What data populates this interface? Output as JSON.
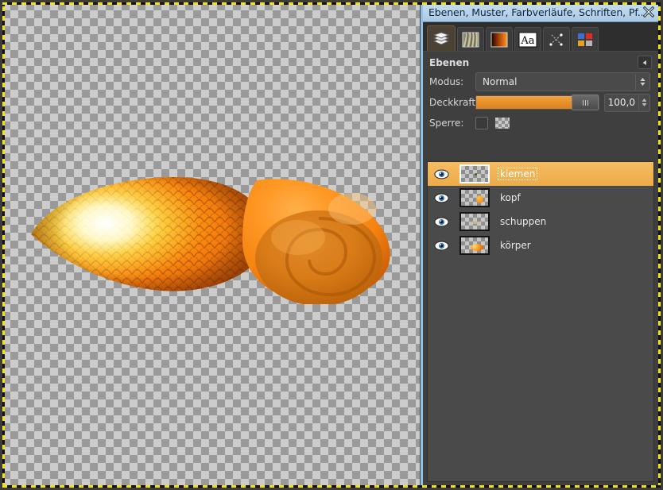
{
  "window": {
    "title": "Ebenen, Muster, Farbverläufe, Schriften, Pf...",
    "close_icon": "close-icon"
  },
  "tabs": [
    {
      "id": "layers",
      "icon": "layers-stack-icon",
      "label": "Ebenen",
      "active": true
    },
    {
      "id": "patterns",
      "icon": "pattern-swatch-icon",
      "label": "Muster",
      "active": false
    },
    {
      "id": "gradients",
      "icon": "gradient-icon",
      "label": "Farbverläufe",
      "active": false
    },
    {
      "id": "fonts",
      "icon": "font-aa-icon",
      "label": "Schriften",
      "active": false
    },
    {
      "id": "paths",
      "icon": "paths-icon",
      "label": "Pfade",
      "active": false
    },
    {
      "id": "palettes",
      "icon": "palette-squares-icon",
      "label": "Paletten",
      "active": false
    }
  ],
  "layers_panel": {
    "section_title": "Ebenen",
    "collapse_icon": "collapse-left-arrow-icon",
    "mode": {
      "label": "Modus:",
      "value": "Normal",
      "arrow_icon": "updown-chevron-icon"
    },
    "opacity": {
      "label": "Deckkraft:",
      "value": "100,0",
      "percent": 100,
      "handle_icon": "slider-grip-icon",
      "stepper_icon": "spinner-arrows-icon"
    },
    "lock": {
      "label": "Sperre:",
      "checkbox_checked": false,
      "alpha_icon": "lock-alpha-checker-icon"
    },
    "layers": [
      {
        "name": "kiemen",
        "visible": true,
        "selected": true,
        "eye_icon": "eye-icon",
        "thumb": "empty"
      },
      {
        "name": "kopf",
        "visible": true,
        "selected": false,
        "eye_icon": "eye-icon",
        "thumb": "small-orange-blob"
      },
      {
        "name": "schuppen",
        "visible": true,
        "selected": false,
        "eye_icon": "eye-icon",
        "thumb": "faint-streak"
      },
      {
        "name": "körper",
        "visible": true,
        "selected": false,
        "eye_icon": "eye-icon",
        "thumb": "orange-body"
      }
    ]
  },
  "canvas": {
    "artwork_name": "orange-scaled-fish-with-shell",
    "background": "transparency-checkerboard"
  },
  "colors": {
    "accent_orange": "#e8902a",
    "selection_orange": "#edab49",
    "panel_bg": "#3f3f3f",
    "titlebar_blue": "#b8d4ea",
    "focus_yellow": "#f2e50c"
  }
}
